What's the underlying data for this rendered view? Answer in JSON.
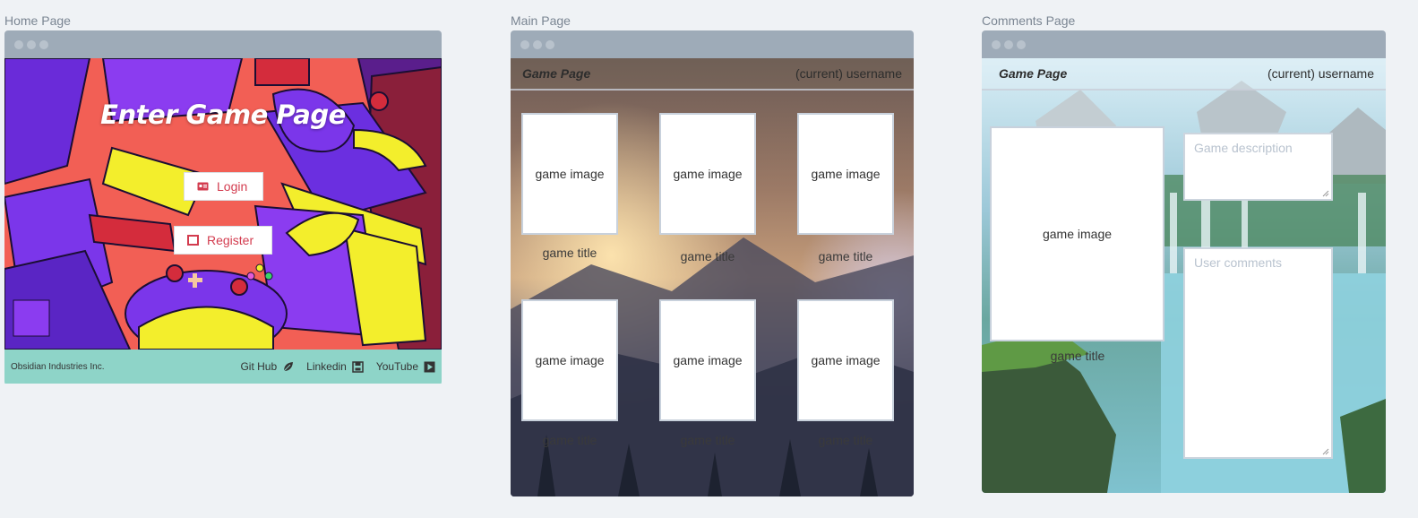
{
  "labels": {
    "home": "Home Page",
    "main": "Main Page",
    "comments": "Comments Page"
  },
  "home": {
    "heading": "Enter Game Page",
    "login_label": "Login",
    "register_label": "Register",
    "footer": {
      "company": "Obsidian Industries Inc.",
      "links": [
        "Git Hub",
        "Linkedin",
        "YouTube"
      ]
    }
  },
  "main": {
    "brand": "Game Page",
    "username": "(current) username",
    "cards": [
      {
        "image": "game image",
        "title": "game title"
      },
      {
        "image": "game image",
        "title": "game title"
      },
      {
        "image": "game image",
        "title": "game title"
      },
      {
        "image": "game image",
        "title": "game title"
      },
      {
        "image": "game image",
        "title": "game title"
      },
      {
        "image": "game image",
        "title": "game title"
      }
    ]
  },
  "comments": {
    "brand": "Game Page",
    "username": "(current) username",
    "image": "game image",
    "title": "game title",
    "description_placeholder": "Game description",
    "comments_placeholder": "User comments"
  },
  "colors": {
    "accent": "#d33c4f",
    "footer": "#8ed4c8",
    "titlebar": "#9eabb8"
  }
}
